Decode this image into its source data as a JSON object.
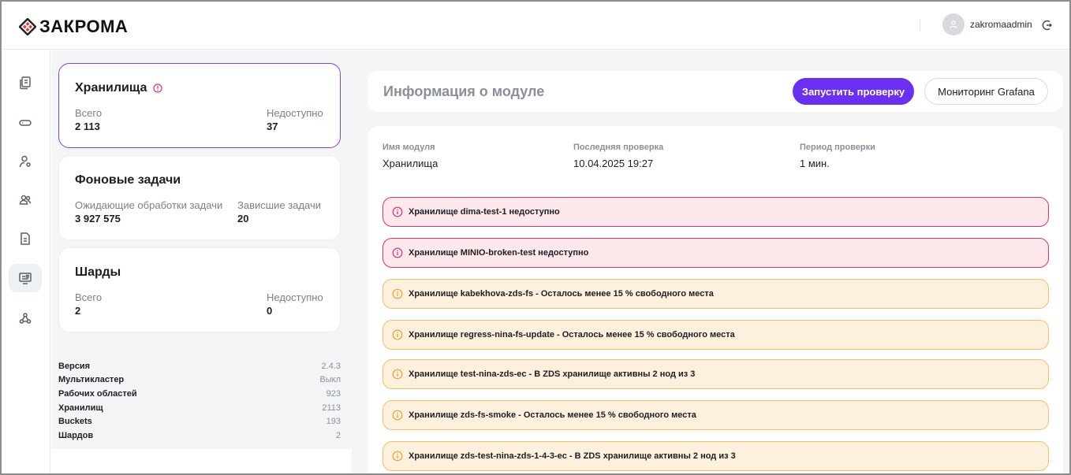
{
  "header": {
    "logo_text": "ЗАКРОМА",
    "username": "zakromaadmin"
  },
  "colors": {
    "accent": "#6b2ff0",
    "error_border": "#d8327a",
    "error_bg": "#fde8ec",
    "warn_border": "#f2c06a",
    "warn_bg": "#fdf0dc"
  },
  "sidebar": {
    "items": [
      {
        "icon": "documents-icon"
      },
      {
        "icon": "storage-drive-icon"
      },
      {
        "icon": "user-settings-icon"
      },
      {
        "icon": "users-icon"
      },
      {
        "icon": "document-icon"
      },
      {
        "icon": "monitor-icon",
        "active": true
      },
      {
        "icon": "network-icon"
      }
    ]
  },
  "cards": {
    "storages": {
      "title": "Хранилища",
      "total_label": "Всего",
      "total_value": "2 113",
      "unavailable_label": "Недоступно",
      "unavailable_value": "37"
    },
    "background_tasks": {
      "title": "Фоновые задачи",
      "pending_label": "Ожидающие обработки задачи",
      "pending_value": "3 927 575",
      "stuck_label": "Зависшие задачи",
      "stuck_value": "20"
    },
    "shards": {
      "title": "Шарды",
      "total_label": "Всего",
      "total_value": "2",
      "unavailable_label": "Недоступно",
      "unavailable_value": "0"
    }
  },
  "stats": [
    {
      "key": "Версия",
      "value": "2.4.3"
    },
    {
      "key": "Мультикластер",
      "value": "Выкл"
    },
    {
      "key": "Рабочих областей",
      "value": "923"
    },
    {
      "key": "Хранилищ",
      "value": "2113"
    },
    {
      "key": "Buckets",
      "value": "193"
    },
    {
      "key": "Шардов",
      "value": "2"
    }
  ],
  "module": {
    "title": "Информация о модуле",
    "run_check_label": "Запустить проверку",
    "grafana_label": "Мониторинг Grafana",
    "name_label": "Имя модуля",
    "name_value": "Хранилища",
    "last_check_label": "Последняя проверка",
    "last_check_value": "10.04.2025 19:27",
    "period_label": "Период проверки",
    "period_value": "1 мин."
  },
  "alerts": [
    {
      "level": "error",
      "text": "Хранилище dima-test-1 недоступно"
    },
    {
      "level": "error",
      "text": "Хранилище MINIO-broken-test недоступно"
    },
    {
      "level": "warn",
      "text": "Хранилище kabekhova-zds-fs - Осталось менее 15 % свободного места"
    },
    {
      "level": "warn",
      "text": "Хранилище regress-nina-fs-update - Осталось менее 15 % свободного места"
    },
    {
      "level": "warn",
      "text": "Хранилище test-nina-zds-ec - В ZDS хранилище активны 2 нод из 3"
    },
    {
      "level": "warn",
      "text": "Хранилище zds-fs-smoke - Осталось менее 15 % свободного места"
    },
    {
      "level": "warn",
      "text": "Хранилище zds-test-nina-zds-1-4-3-ec - В ZDS хранилище активны 2 нод из 3"
    }
  ]
}
